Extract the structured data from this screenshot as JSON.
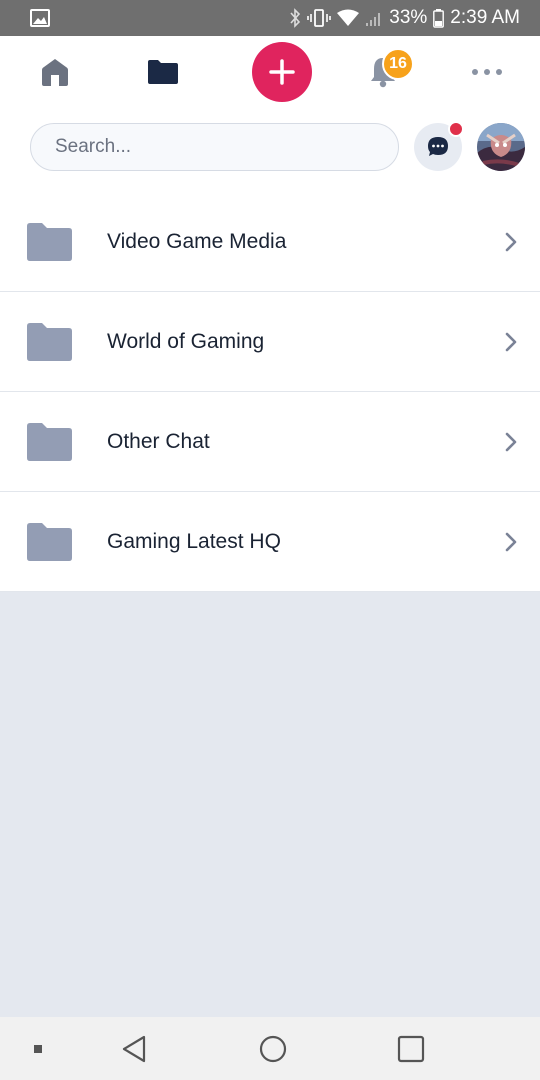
{
  "status_bar": {
    "battery": "33%",
    "time": "2:39 AM",
    "icons": [
      "image-icon",
      "bluetooth-icon",
      "vibrate-icon",
      "wifi-icon",
      "signal-icon",
      "battery-icon"
    ]
  },
  "nav": {
    "notifications_count": "16",
    "accent_color": "#e0245e",
    "badge_color": "#f7a21b"
  },
  "search": {
    "placeholder": "Search..."
  },
  "folders": [
    {
      "label": "Video Game Media"
    },
    {
      "label": "World of Gaming"
    },
    {
      "label": "Other Chat"
    },
    {
      "label": "Gaming Latest HQ"
    }
  ]
}
